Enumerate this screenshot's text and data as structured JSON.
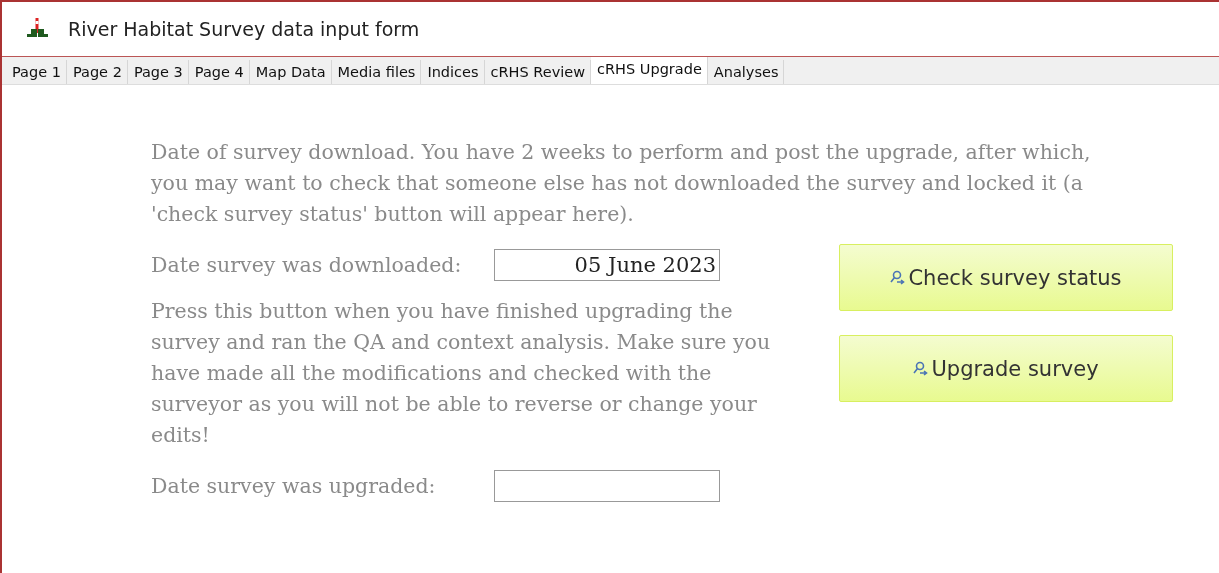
{
  "window": {
    "title": "River Habitat Survey data input form"
  },
  "tabs": [
    {
      "label": "Page 1",
      "selected": false
    },
    {
      "label": "Page 2",
      "selected": false
    },
    {
      "label": "Page 3",
      "selected": false
    },
    {
      "label": "Page 4",
      "selected": false
    },
    {
      "label": "Map Data",
      "selected": false
    },
    {
      "label": "Media files",
      "selected": false
    },
    {
      "label": "Indices",
      "selected": false
    },
    {
      "label": "cRHS Review",
      "selected": false
    },
    {
      "label": "cRHS Upgrade",
      "selected": true
    },
    {
      "label": "Analyses",
      "selected": false
    }
  ],
  "intro": "Date of survey download. You have 2 weeks to perform and post the upgrade, after which, you may want to check that someone else has not downloaded the survey and locked it (a 'check survey status' button will appear here).",
  "downloaded": {
    "label": "Date survey was downloaded:",
    "value": "05 June 2023"
  },
  "instructions": "Press this button when you have finished upgrading the survey and ran the QA and context analysis. Make sure you have made all the modifications and checked with the surveyor as you will not be able to reverse or change your edits!",
  "upgraded": {
    "label": "Date survey was upgraded:"
  },
  "buttons": [
    "Check survey status",
    "Upgrade survey"
  ]
}
